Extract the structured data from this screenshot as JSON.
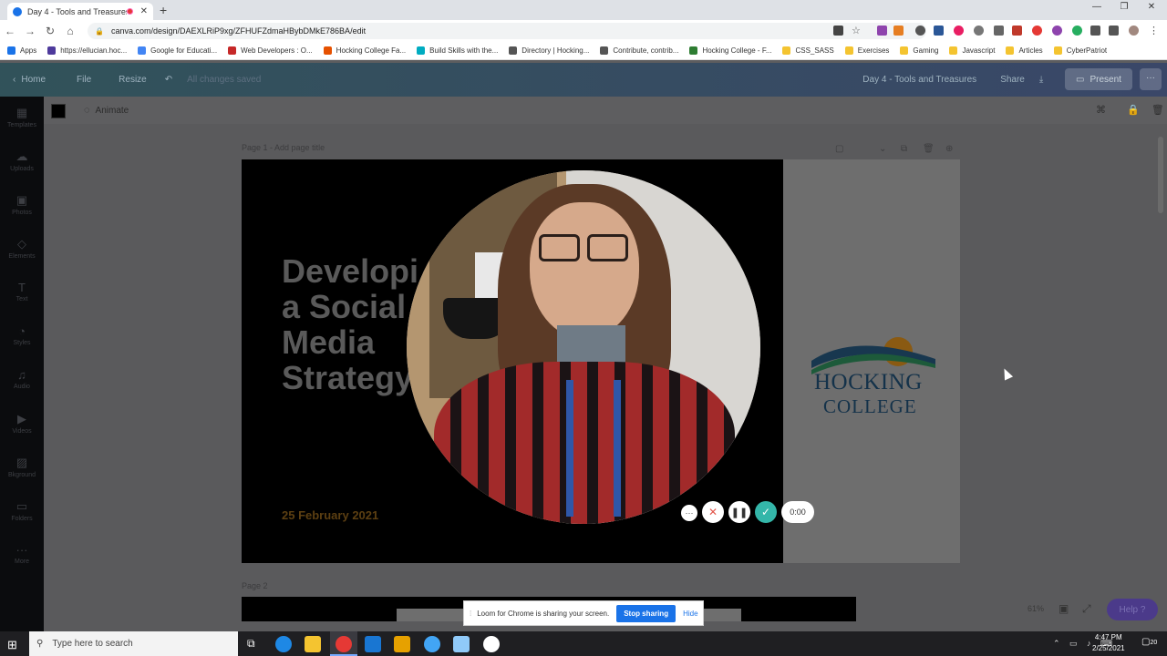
{
  "browser": {
    "tab_title": "Day 4 - Tools and Treasures",
    "url": "canva.com/design/DAEXLRiP9xg/ZFHUFZdmaHBybDMkE786BA/edit",
    "bookmarks": [
      {
        "label": "Apps",
        "color": "#1a73e8"
      },
      {
        "label": "https://ellucian.hoc...",
        "color": "#4e3a9c"
      },
      {
        "label": "Google for Educati...",
        "color": "#4285f4"
      },
      {
        "label": "Web Developers : O...",
        "color": "#c62828"
      },
      {
        "label": "Hocking College Fa...",
        "color": "#e65100"
      },
      {
        "label": "Build Skills with the...",
        "color": "#00acc1"
      },
      {
        "label": "Directory | Hocking...",
        "color": "#555555"
      },
      {
        "label": "Contribute, contrib...",
        "color": "#555555"
      },
      {
        "label": "Hocking College - F...",
        "color": "#2e7d32"
      },
      {
        "label": "CSS_SASS",
        "color": "#f4c430"
      },
      {
        "label": "Exercises",
        "color": "#f4c430"
      },
      {
        "label": "Gaming",
        "color": "#f4c430"
      },
      {
        "label": "Javascript",
        "color": "#f4c430"
      },
      {
        "label": "Articles",
        "color": "#f4c430"
      },
      {
        "label": "CyberPatriot",
        "color": "#f4c430"
      }
    ]
  },
  "canva": {
    "header": {
      "home": "Home",
      "file": "File",
      "resize": "Resize",
      "saved": "All changes saved",
      "design_title": "Day 4 - Tools and Treasures",
      "share": "Share",
      "present": "Present"
    },
    "sidebar": [
      {
        "label": "Templates",
        "icon": "templates-icon",
        "glyph": "▦"
      },
      {
        "label": "Uploads",
        "icon": "uploads-icon",
        "glyph": "☁"
      },
      {
        "label": "Photos",
        "icon": "photos-icon",
        "glyph": "▣"
      },
      {
        "label": "Elements",
        "icon": "elements-icon",
        "glyph": "◇"
      },
      {
        "label": "Text",
        "icon": "text-icon",
        "glyph": "T"
      },
      {
        "label": "Styles",
        "icon": "styles-icon",
        "glyph": "◔"
      },
      {
        "label": "Audio",
        "icon": "audio-icon",
        "glyph": "♫"
      },
      {
        "label": "Videos",
        "icon": "videos-icon",
        "glyph": "▶"
      },
      {
        "label": "Bkground",
        "icon": "background-icon",
        "glyph": "▨"
      },
      {
        "label": "Folders",
        "icon": "folders-icon",
        "glyph": "▭"
      },
      {
        "label": "More",
        "icon": "more-icon",
        "glyph": "···"
      }
    ],
    "toolbar": {
      "animate": "Animate"
    },
    "page1_label": "Page 1 - Add page title",
    "page2_label": "Page 2",
    "slide": {
      "title": "Developi\na Social\nMedia\nStrategy",
      "date": "25 February 2021",
      "logo_line1": "HOCKING",
      "logo_line2": "COLLEGE"
    },
    "zoom": "61%",
    "help": "Help ?"
  },
  "loom": {
    "timer": "0:00",
    "share_message": "Loom for Chrome is sharing your screen.",
    "stop_sharing": "Stop sharing",
    "hide": "Hide"
  },
  "taskbar": {
    "search_placeholder": "Type here to search",
    "time": "4:47 PM",
    "date": "2/25/2021",
    "notifications": "20"
  }
}
